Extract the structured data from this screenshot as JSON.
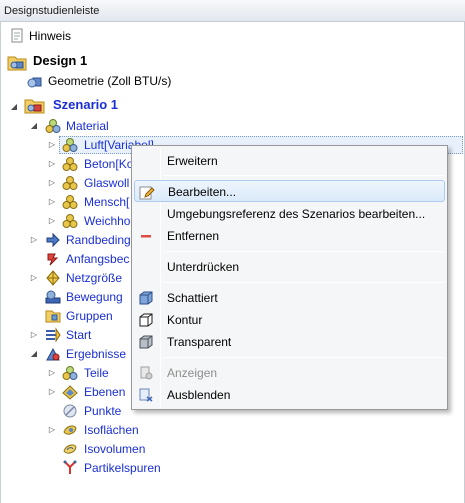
{
  "window": {
    "title": "Designstudienleiste"
  },
  "tree": {
    "hinweis": "Hinweis",
    "design": "Design 1",
    "geometrie": "Geometrie (Zoll BTU/s)",
    "szenario": "Szenario 1",
    "material": "Material",
    "luft": "Luft[Variabel]",
    "beton": "Beton[Ko",
    "glaswolle": "Glaswoll",
    "mensch": "Mensch[",
    "weichholz": "Weichho",
    "randbedingungen": "Randbeding",
    "anfangsbedingungen": "Anfangsbec",
    "netzgroesse": "Netzgröße",
    "bewegung": "Bewegung",
    "gruppen": "Gruppen",
    "start": "Start",
    "ergebnisse": "Ergebnisse",
    "teile": "Teile",
    "ebenen": "Ebenen",
    "punkte": "Punkte",
    "isoflaechen": "Isoflächen",
    "isovolumen": "Isovolumen",
    "partikelspuren": "Partikelspuren"
  },
  "context_menu": {
    "erweitern": "Erweitern",
    "bearbeiten": "Bearbeiten...",
    "umgebungsreferenz": "Umgebungsreferenz des Szenarios bearbeiten...",
    "entfernen": "Entfernen",
    "unterdruecken": "Unterdrücken",
    "schattiert": "Schattiert",
    "kontur": "Kontur",
    "transparent": "Transparent",
    "anzeigen": "Anzeigen",
    "ausblenden": "Ausblenden"
  },
  "colors": {
    "link_blue": "#1a2fd6",
    "highlight": "#dbeafa",
    "menu_bg": "#f5f6f7"
  }
}
